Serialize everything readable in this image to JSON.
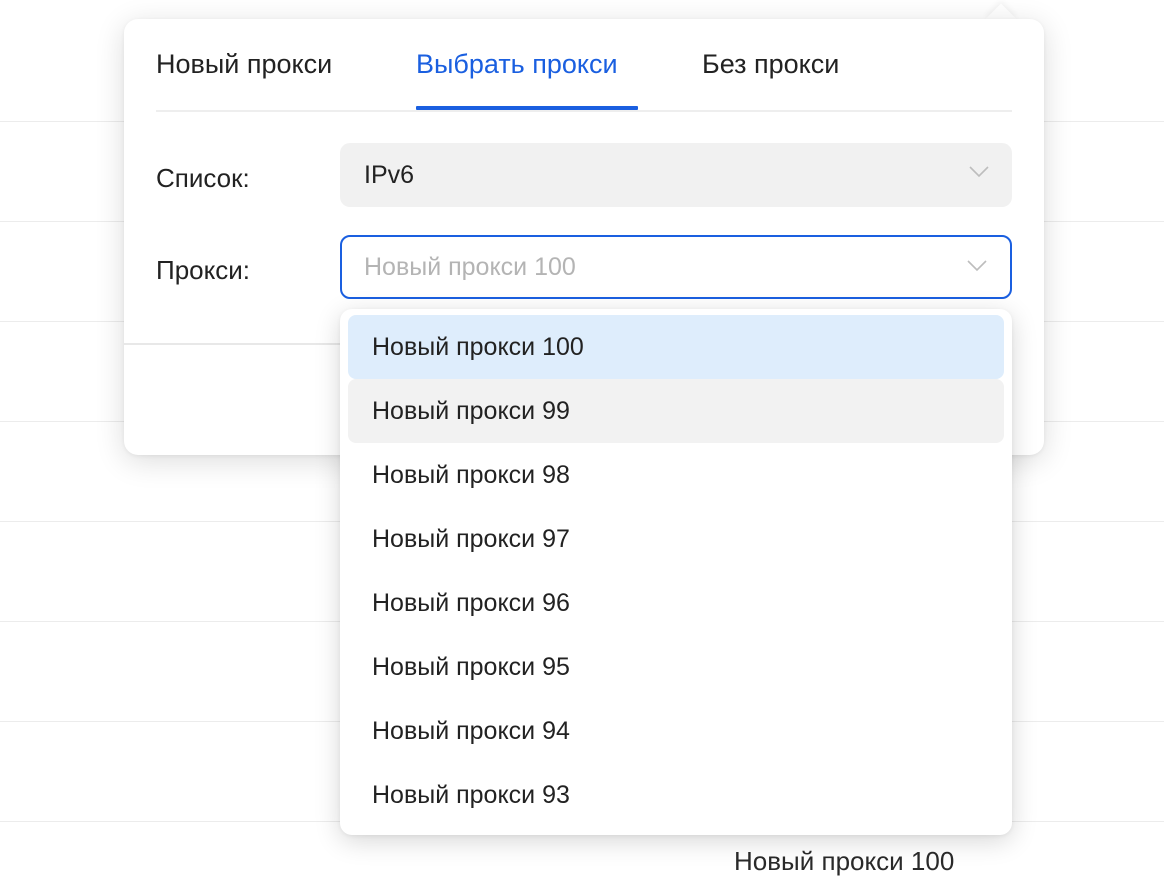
{
  "background": {
    "bottom_text": "Новый прокси 100"
  },
  "tabs": [
    {
      "label": "Новый прокси",
      "active": false
    },
    {
      "label": "Выбрать прокси",
      "active": true
    },
    {
      "label": "Без прокси",
      "active": false
    }
  ],
  "form": {
    "list_label": "Список:",
    "list_value": "IPv6",
    "proxy_label": "Прокси:",
    "proxy_placeholder": "Новый прокси 100"
  },
  "dropdown": {
    "options": [
      "Новый прокси 100",
      "Новый прокси 99",
      "Новый прокси 98",
      "Новый прокси 97",
      "Новый прокси 96",
      "Новый прокси 95",
      "Новый прокси 94",
      "Новый прокси 93"
    ],
    "selected_index": 0,
    "hovered_index": 1
  },
  "colors": {
    "accent": "#1a5fe0",
    "selected_option_bg": "#deedfc",
    "hovered_option_bg": "#f2f2f2"
  },
  "icons": {
    "select_chevron": "chevron-down-icon"
  }
}
